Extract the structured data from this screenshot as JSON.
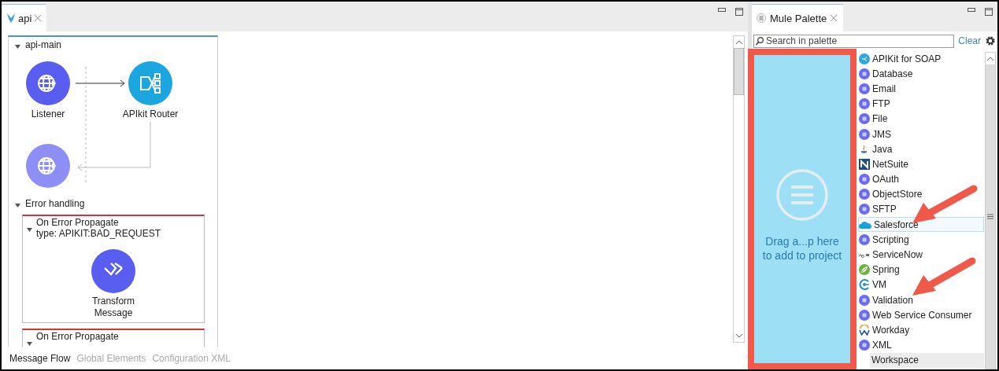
{
  "editor": {
    "tabs": [
      {
        "label": "api",
        "selected": true
      }
    ],
    "flow": {
      "title": "api-main",
      "expanded": true,
      "nodes": [
        {
          "label": "Listener",
          "kind": "listener"
        },
        {
          "label": "APIkit Router",
          "kind": "router"
        }
      ]
    },
    "error_handling": {
      "title": "Error handling",
      "expanded": true,
      "handlers": [
        {
          "title": "On Error Propagate",
          "type": "type: APIKIT:BAD_REQUEST",
          "expanded": true,
          "node": {
            "label": "Transform Message"
          }
        },
        {
          "title": "On Error Propagate",
          "expanded": true
        }
      ]
    },
    "bottom_tabs": [
      {
        "label": "Message Flow",
        "selected": true
      },
      {
        "label": "Global Elements",
        "selected": false
      },
      {
        "label": "Configuration XML",
        "selected": false
      }
    ]
  },
  "palette": {
    "tab": {
      "label": "Mule Palette",
      "selected": true
    },
    "search": {
      "placeholder": "Search in palette"
    },
    "clear": "Clear",
    "drop_zone": {
      "lines": [
        "Drag a...p here",
        "to add to project"
      ]
    },
    "items": [
      {
        "label": "APIKit for SOAP",
        "kind": "soap",
        "selected": false
      },
      {
        "label": "Database",
        "kind": "connector",
        "selected": false
      },
      {
        "label": "Email",
        "kind": "connector",
        "selected": false
      },
      {
        "label": "FTP",
        "kind": "connector",
        "selected": false
      },
      {
        "label": "File",
        "kind": "connector",
        "selected": false
      },
      {
        "label": "JMS",
        "kind": "connector",
        "selected": false
      },
      {
        "label": "Java",
        "kind": "java",
        "selected": false
      },
      {
        "label": "NetSuite",
        "kind": "netsuite",
        "selected": false
      },
      {
        "label": "OAuth",
        "kind": "connector",
        "selected": false
      },
      {
        "label": "ObjectStore",
        "kind": "connector",
        "selected": false
      },
      {
        "label": "SFTP",
        "kind": "connector",
        "selected": false
      },
      {
        "label": "Salesforce",
        "kind": "cloud",
        "selected": true
      },
      {
        "label": "Scripting",
        "kind": "connector",
        "selected": false
      },
      {
        "label": "ServiceNow",
        "kind": "now",
        "selected": false
      },
      {
        "label": "Spring",
        "kind": "spring",
        "selected": false
      },
      {
        "label": "VM",
        "kind": "vm",
        "selected": false
      },
      {
        "label": "Validation",
        "kind": "connector",
        "selected": false
      },
      {
        "label": "Web Service Consumer",
        "kind": "connector",
        "selected": false
      },
      {
        "label": "Workday",
        "kind": "workday",
        "selected": false
      },
      {
        "label": "XML",
        "kind": "connector",
        "selected": false
      },
      {
        "label": "Workspace",
        "kind": "category",
        "selected": false
      }
    ]
  }
}
